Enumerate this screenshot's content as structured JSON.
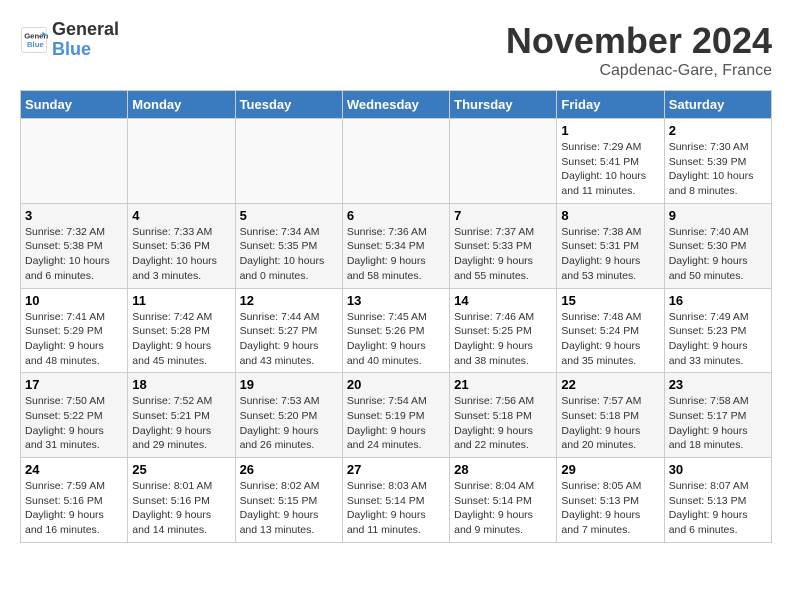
{
  "header": {
    "logo_line1": "General",
    "logo_line2": "Blue",
    "month_title": "November 2024",
    "location": "Capdenac-Gare, France"
  },
  "days_of_week": [
    "Sunday",
    "Monday",
    "Tuesday",
    "Wednesday",
    "Thursday",
    "Friday",
    "Saturday"
  ],
  "weeks": [
    [
      {
        "day": "",
        "info": ""
      },
      {
        "day": "",
        "info": ""
      },
      {
        "day": "",
        "info": ""
      },
      {
        "day": "",
        "info": ""
      },
      {
        "day": "",
        "info": ""
      },
      {
        "day": "1",
        "info": "Sunrise: 7:29 AM\nSunset: 5:41 PM\nDaylight: 10 hours and 11 minutes."
      },
      {
        "day": "2",
        "info": "Sunrise: 7:30 AM\nSunset: 5:39 PM\nDaylight: 10 hours and 8 minutes."
      }
    ],
    [
      {
        "day": "3",
        "info": "Sunrise: 7:32 AM\nSunset: 5:38 PM\nDaylight: 10 hours and 6 minutes."
      },
      {
        "day": "4",
        "info": "Sunrise: 7:33 AM\nSunset: 5:36 PM\nDaylight: 10 hours and 3 minutes."
      },
      {
        "day": "5",
        "info": "Sunrise: 7:34 AM\nSunset: 5:35 PM\nDaylight: 10 hours and 0 minutes."
      },
      {
        "day": "6",
        "info": "Sunrise: 7:36 AM\nSunset: 5:34 PM\nDaylight: 9 hours and 58 minutes."
      },
      {
        "day": "7",
        "info": "Sunrise: 7:37 AM\nSunset: 5:33 PM\nDaylight: 9 hours and 55 minutes."
      },
      {
        "day": "8",
        "info": "Sunrise: 7:38 AM\nSunset: 5:31 PM\nDaylight: 9 hours and 53 minutes."
      },
      {
        "day": "9",
        "info": "Sunrise: 7:40 AM\nSunset: 5:30 PM\nDaylight: 9 hours and 50 minutes."
      }
    ],
    [
      {
        "day": "10",
        "info": "Sunrise: 7:41 AM\nSunset: 5:29 PM\nDaylight: 9 hours and 48 minutes."
      },
      {
        "day": "11",
        "info": "Sunrise: 7:42 AM\nSunset: 5:28 PM\nDaylight: 9 hours and 45 minutes."
      },
      {
        "day": "12",
        "info": "Sunrise: 7:44 AM\nSunset: 5:27 PM\nDaylight: 9 hours and 43 minutes."
      },
      {
        "day": "13",
        "info": "Sunrise: 7:45 AM\nSunset: 5:26 PM\nDaylight: 9 hours and 40 minutes."
      },
      {
        "day": "14",
        "info": "Sunrise: 7:46 AM\nSunset: 5:25 PM\nDaylight: 9 hours and 38 minutes."
      },
      {
        "day": "15",
        "info": "Sunrise: 7:48 AM\nSunset: 5:24 PM\nDaylight: 9 hours and 35 minutes."
      },
      {
        "day": "16",
        "info": "Sunrise: 7:49 AM\nSunset: 5:23 PM\nDaylight: 9 hours and 33 minutes."
      }
    ],
    [
      {
        "day": "17",
        "info": "Sunrise: 7:50 AM\nSunset: 5:22 PM\nDaylight: 9 hours and 31 minutes."
      },
      {
        "day": "18",
        "info": "Sunrise: 7:52 AM\nSunset: 5:21 PM\nDaylight: 9 hours and 29 minutes."
      },
      {
        "day": "19",
        "info": "Sunrise: 7:53 AM\nSunset: 5:20 PM\nDaylight: 9 hours and 26 minutes."
      },
      {
        "day": "20",
        "info": "Sunrise: 7:54 AM\nSunset: 5:19 PM\nDaylight: 9 hours and 24 minutes."
      },
      {
        "day": "21",
        "info": "Sunrise: 7:56 AM\nSunset: 5:18 PM\nDaylight: 9 hours and 22 minutes."
      },
      {
        "day": "22",
        "info": "Sunrise: 7:57 AM\nSunset: 5:18 PM\nDaylight: 9 hours and 20 minutes."
      },
      {
        "day": "23",
        "info": "Sunrise: 7:58 AM\nSunset: 5:17 PM\nDaylight: 9 hours and 18 minutes."
      }
    ],
    [
      {
        "day": "24",
        "info": "Sunrise: 7:59 AM\nSunset: 5:16 PM\nDaylight: 9 hours and 16 minutes."
      },
      {
        "day": "25",
        "info": "Sunrise: 8:01 AM\nSunset: 5:16 PM\nDaylight: 9 hours and 14 minutes."
      },
      {
        "day": "26",
        "info": "Sunrise: 8:02 AM\nSunset: 5:15 PM\nDaylight: 9 hours and 13 minutes."
      },
      {
        "day": "27",
        "info": "Sunrise: 8:03 AM\nSunset: 5:14 PM\nDaylight: 9 hours and 11 minutes."
      },
      {
        "day": "28",
        "info": "Sunrise: 8:04 AM\nSunset: 5:14 PM\nDaylight: 9 hours and 9 minutes."
      },
      {
        "day": "29",
        "info": "Sunrise: 8:05 AM\nSunset: 5:13 PM\nDaylight: 9 hours and 7 minutes."
      },
      {
        "day": "30",
        "info": "Sunrise: 8:07 AM\nSunset: 5:13 PM\nDaylight: 9 hours and 6 minutes."
      }
    ]
  ]
}
